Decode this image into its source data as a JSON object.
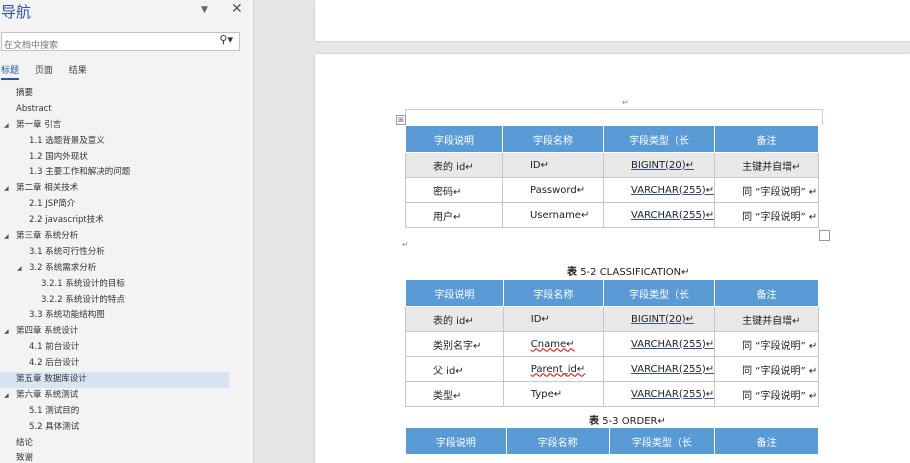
{
  "nav": {
    "title": "导航",
    "search_placeholder": "在文档中搜索",
    "tabs": [
      "标题",
      "页面",
      "结果"
    ],
    "items": [
      {
        "label": "摘要",
        "level": 0,
        "expand": false
      },
      {
        "label": "Abstract",
        "level": 0,
        "expand": false
      },
      {
        "label": "第一章 引言",
        "level": 0,
        "expand": true
      },
      {
        "label": "1.1 选题背景及意义",
        "level": 1,
        "expand": false
      },
      {
        "label": "1.2 国内外现状",
        "level": 1,
        "expand": false
      },
      {
        "label": "1.3 主要工作和解决的问题",
        "level": 1,
        "expand": false
      },
      {
        "label": "第二章 相关技术",
        "level": 0,
        "expand": true
      },
      {
        "label": "2.1 JSP简介",
        "level": 1,
        "expand": false
      },
      {
        "label": "2.2 javascript技术",
        "level": 1,
        "expand": false
      },
      {
        "label": "第三章 系统分析",
        "level": 0,
        "expand": true
      },
      {
        "label": "3.1 系统可行性分析",
        "level": 1,
        "expand": false
      },
      {
        "label": "3.2 系统需求分析",
        "level": 1,
        "expand": true
      },
      {
        "label": "3.2.1 系统设计的目标",
        "level": 2,
        "expand": false
      },
      {
        "label": "3.2.2 系统设计的特点",
        "level": 2,
        "expand": false
      },
      {
        "label": "3.3 系统功能结构图",
        "level": 1,
        "expand": false
      },
      {
        "label": "第四章 系统设计",
        "level": 0,
        "expand": true
      },
      {
        "label": "4.1 前台设计",
        "level": 1,
        "expand": false
      },
      {
        "label": "4.2 后台设计",
        "level": 1,
        "expand": false
      },
      {
        "label": "第五章 数据库设计",
        "level": 0,
        "expand": false,
        "selected": true
      },
      {
        "label": "第六章 系统测试",
        "level": 0,
        "expand": true
      },
      {
        "label": "5.1 测试目的",
        "level": 1,
        "expand": false
      },
      {
        "label": "5.2 具体测试",
        "level": 1,
        "expand": false
      },
      {
        "label": "结论",
        "level": 0,
        "expand": false
      },
      {
        "label": "致谢",
        "level": 0,
        "expand": false
      }
    ]
  },
  "doc": {
    "headers": [
      "字段说明",
      "字段名称",
      "字段类型（长",
      "备注"
    ],
    "table1": [
      [
        "表的 id↵",
        "ID↵",
        "BIGINT(20)↵",
        "主键并自增↵"
      ],
      [
        "密码↵",
        "Password↵",
        "VARCHAR(255)↵",
        "同 “字段说明” ↵"
      ],
      [
        "用户↵",
        "Username↵",
        "VARCHAR(255)↵",
        "同 “字段说明” ↵"
      ]
    ],
    "caption2_prefix": "表",
    "caption2_text": "5-2 CLASSIFICATION↵",
    "table2": [
      [
        "表的 id↵",
        "ID↵",
        "BIGINT(20)↵",
        "主键并自增↵"
      ],
      [
        "类别名字↵",
        "Cname↵",
        "VARCHAR(255)↵",
        "同 “字段说明” ↵"
      ],
      [
        "父 id↵",
        "Parent_id↵",
        "VARCHAR(255)↵",
        "同 “字段说明” ↵"
      ],
      [
        "类型↵",
        "Type↵",
        "VARCHAR(255)↵",
        "同 “字段说明” ↵"
      ]
    ],
    "caption3_prefix": "表",
    "caption3_text": "5-3 ORDER↵",
    "para_mark": "↵",
    "move_handle": "⊞"
  },
  "colors": {
    "header_bg": "#5b9bd5",
    "nav_selected": "#d8e4f2",
    "accent": "#2b579a"
  }
}
